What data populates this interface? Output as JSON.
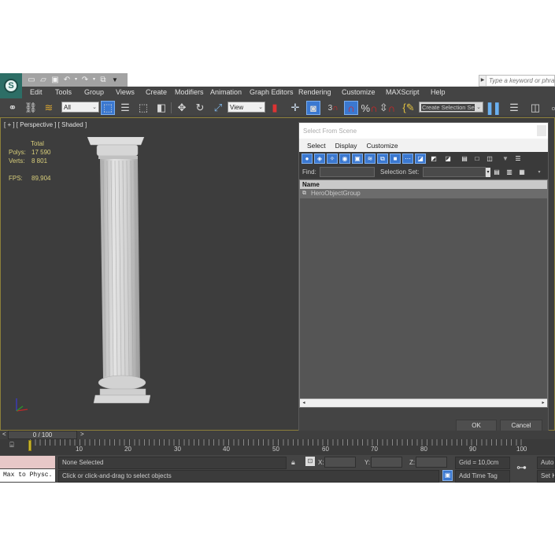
{
  "quick_access": {
    "icons": [
      "new-file-icon",
      "open-folder-icon",
      "save-icon",
      "undo-icon",
      "redo-icon",
      "project-icon",
      "dropdown-icon"
    ],
    "search_placeholder": "Type a keyword or phrase"
  },
  "menu": {
    "items": [
      "Edit",
      "Tools",
      "Group",
      "Views",
      "Create",
      "Modifiers",
      "Animation",
      "Graph Editors",
      "Rendering",
      "Customize",
      "MAXScript",
      "Help"
    ]
  },
  "toolbar": {
    "selection_filter": "All",
    "reference_coord": "View",
    "named_selection_placeholder": "Create Selection Se",
    "snap_3d_label": "3"
  },
  "viewport": {
    "label": "[ + ] [ Perspective ] [ Shaded ]",
    "stats": {
      "header": "Total",
      "polys_label": "Polys:",
      "polys_value": "17 590",
      "verts_label": "Verts:",
      "verts_value": "8 801",
      "fps_label": "FPS:",
      "fps_value": "89,904"
    }
  },
  "dialog": {
    "title": "Select From Scene",
    "menu": [
      "Select",
      "Display",
      "Customize"
    ],
    "find_label": "Find:",
    "find_value": "",
    "selection_set_label": "Selection Set:",
    "selection_set_value": "",
    "column_header": "Name",
    "rows": [
      "HeroObjectGroup"
    ],
    "ok_label": "OK",
    "cancel_label": "Cancel"
  },
  "timeline": {
    "position": "0 / 100",
    "current_frame": 0,
    "tick_labels": [
      "10",
      "20",
      "30",
      "40",
      "50",
      "60",
      "70",
      "80",
      "90",
      "100"
    ]
  },
  "status": {
    "script_listener": "Max to Physc.",
    "selection": "None Selected",
    "prompt": "Click or click-and-drag to select objects",
    "x_label": "X:",
    "y_label": "Y:",
    "z_label": "Z:",
    "x_value": "",
    "y_value": "",
    "z_value": "",
    "grid": "Grid = 10,0cm",
    "add_time_tag": "Add Time Tag",
    "auto_key": "Auto K",
    "set_key": "Set K"
  }
}
